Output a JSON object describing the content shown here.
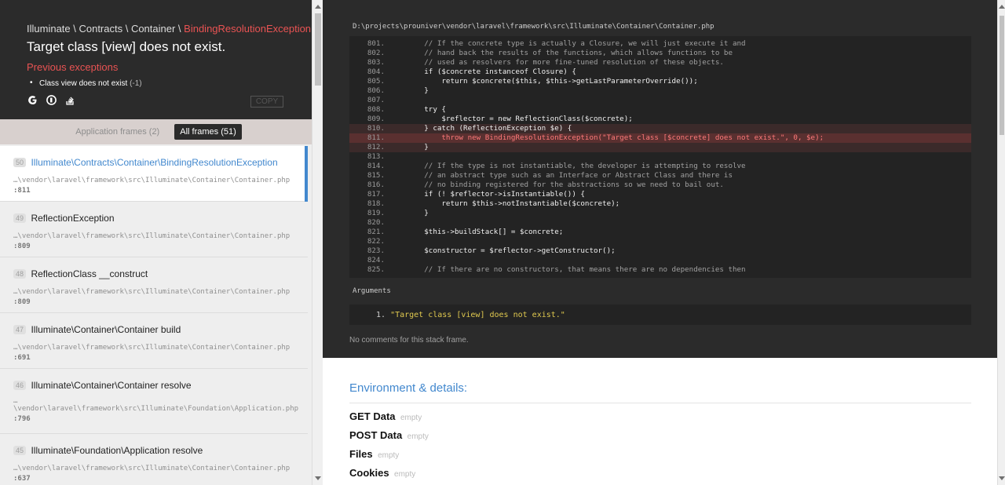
{
  "exception": {
    "class_prefix": "Illuminate \\ Contracts \\ Container \\ ",
    "class_last": "BindingResolutionException",
    "message": "Target class [view] does not exist.",
    "previous_title": "Previous exceptions",
    "previous": [
      {
        "text": "Class view does not exist",
        "code": "(-1)"
      }
    ],
    "icons": [
      "google-icon",
      "duckduckgo-icon",
      "stackoverflow-icon"
    ],
    "copy_label": "COPY"
  },
  "frame_tabs": {
    "application": "Application frames (2)",
    "all": "All frames (51)"
  },
  "frames": [
    {
      "num": "50",
      "cls": "Illuminate\\Contracts\\Container\\BindingResolutionException",
      "path": "…\\vendor\\laravel\\framework\\src\\Illuminate\\Container\\Container.php",
      "line": ":811"
    },
    {
      "num": "49",
      "cls": "ReflectionException",
      "path": "…\\vendor\\laravel\\framework\\src\\Illuminate\\Container\\Container.php",
      "line": ":809"
    },
    {
      "num": "48",
      "cls": "ReflectionClass __construct",
      "path": "…\\vendor\\laravel\\framework\\src\\Illuminate\\Container\\Container.php",
      "line": ":809"
    },
    {
      "num": "47",
      "cls": "Illuminate\\Container\\Container build",
      "path": "…\\vendor\\laravel\\framework\\src\\Illuminate\\Container\\Container.php",
      "line": ":691"
    },
    {
      "num": "46",
      "cls": "Illuminate\\Container\\Container resolve",
      "path_prefix": "…",
      "path": "\\vendor\\laravel\\framework\\src\\Illuminate\\Foundation\\Application.php",
      "line": ":796"
    },
    {
      "num": "45",
      "cls": "Illuminate\\Foundation\\Application resolve",
      "path": "…\\vendor\\laravel\\framework\\src\\Illuminate\\Container\\Container.php",
      "line": ":637"
    }
  ],
  "code": {
    "file": "D:\\projects\\prouniver\\vendor\\laravel\\framework\\src\\Illuminate\\Container\\Container.php",
    "lines": [
      {
        "n": "801.",
        "t": "        // If the concrete type is actually a Closure, we will just execute it and",
        "k": "comment"
      },
      {
        "n": "802.",
        "t": "        // hand back the results of the functions, which allows functions to be",
        "k": "comment"
      },
      {
        "n": "803.",
        "t": "        // used as resolvers for more fine-tuned resolution of these objects.",
        "k": "comment"
      },
      {
        "n": "804.",
        "t": "        if ($concrete instanceof Closure) {",
        "k": "code"
      },
      {
        "n": "805.",
        "t": "            return $concrete($this, $this->getLastParameterOverride());",
        "k": "code"
      },
      {
        "n": "806.",
        "t": "        }",
        "k": "code"
      },
      {
        "n": "807.",
        "t": "",
        "k": "code"
      },
      {
        "n": "808.",
        "t": "        try {",
        "k": "code"
      },
      {
        "n": "809.",
        "t": "            $reflector = new ReflectionClass($concrete);",
        "k": "code"
      },
      {
        "n": "810.",
        "t": "        } catch (ReflectionException $e) {",
        "k": "code",
        "hl": "hl"
      },
      {
        "n": "811.",
        "t": "            throw new BindingResolutionException(\"Target class [$concrete] does not exist.\", 0, $e);",
        "k": "code",
        "hl": "hl2"
      },
      {
        "n": "812.",
        "t": "        }",
        "k": "code",
        "hl": "hl"
      },
      {
        "n": "813.",
        "t": "",
        "k": "code"
      },
      {
        "n": "814.",
        "t": "        // If the type is not instantiable, the developer is attempting to resolve",
        "k": "comment"
      },
      {
        "n": "815.",
        "t": "        // an abstract type such as an Interface or Abstract Class and there is",
        "k": "comment"
      },
      {
        "n": "816.",
        "t": "        // no binding registered for the abstractions so we need to bail out.",
        "k": "comment"
      },
      {
        "n": "817.",
        "t": "        if (! $reflector->isInstantiable()) {",
        "k": "code"
      },
      {
        "n": "818.",
        "t": "            return $this->notInstantiable($concrete);",
        "k": "code"
      },
      {
        "n": "819.",
        "t": "        }",
        "k": "code"
      },
      {
        "n": "820.",
        "t": "",
        "k": "code"
      },
      {
        "n": "821.",
        "t": "        $this->buildStack[] = $concrete;",
        "k": "code"
      },
      {
        "n": "822.",
        "t": "",
        "k": "code"
      },
      {
        "n": "823.",
        "t": "        $constructor = $reflector->getConstructor();",
        "k": "code"
      },
      {
        "n": "824.",
        "t": "",
        "k": "code"
      },
      {
        "n": "825.",
        "t": "        // If there are no constructors, that means there are no dependencies then",
        "k": "comment"
      }
    ]
  },
  "arguments": {
    "label": "Arguments",
    "items": [
      "\"Target class [view] does not exist.\""
    ]
  },
  "no_comments": "No comments for this stack frame.",
  "environment": {
    "title": "Environment & details:",
    "rows": [
      {
        "k": "GET Data",
        "v": "empty"
      },
      {
        "k": "POST Data",
        "v": "empty"
      },
      {
        "k": "Files",
        "v": "empty"
      },
      {
        "k": "Cookies",
        "v": "empty"
      }
    ]
  },
  "colors": {
    "accent": "#4288ce",
    "error": "#e95353",
    "dark_bg": "#2b2b2b"
  }
}
